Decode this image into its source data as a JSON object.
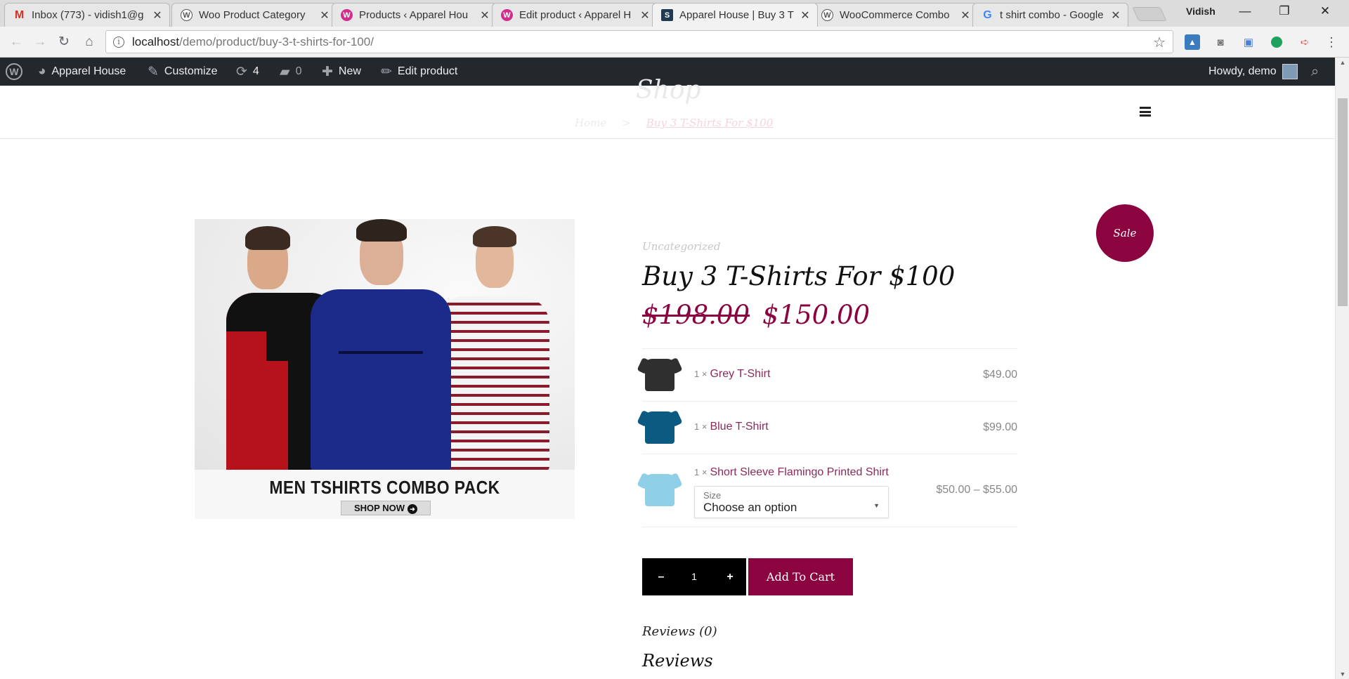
{
  "browser": {
    "tabs": [
      {
        "title": "Inbox (773) - vidish1@g",
        "icon": "gmail-icon",
        "color": "#d93025"
      },
      {
        "title": "Woo Product Category",
        "icon": "wordpress-icon",
        "color": "#555555"
      },
      {
        "title": "Products ‹ Apparel Hou",
        "icon": "woocommerce-icon",
        "color": "#d42c8d"
      },
      {
        "title": "Edit product ‹ Apparel H",
        "icon": "woocommerce-icon",
        "color": "#d42c8d"
      },
      {
        "title": "Apparel House | Buy 3 T",
        "icon": "site-icon",
        "color": "#1f3a52"
      },
      {
        "title": "WooCommerce Combo",
        "icon": "wordpress-icon",
        "color": "#555555"
      },
      {
        "title": "t shirt combo - Google",
        "icon": "google-icon",
        "color": "#4285f4"
      }
    ],
    "profile": "Vidish",
    "url_host": "localhost",
    "url_path": "/demo/product/buy-3-t-shirts-for-100/"
  },
  "adminbar": {
    "site_name": "Apparel House",
    "customize": "Customize",
    "updates": "4",
    "comments": "0",
    "new": "New",
    "edit_product": "Edit product",
    "howdy": "Howdy, demo"
  },
  "header": {
    "page_title": "Shop",
    "breadcrumb_home": "Home",
    "breadcrumb_sep": ">",
    "breadcrumb_current": "Buy 3 T-Shirts For $100"
  },
  "product": {
    "image_caption": "MEN TSHIRTS COMBO PACK",
    "image_button": "SHOP NOW",
    "sale_badge": "Sale",
    "category": "Uncategorized",
    "title": "Buy 3 T-Shirts For $100",
    "regular_price": "$198.00",
    "sale_price": "$150.00",
    "items": [
      {
        "qty": "1 ×",
        "name": "Grey T-Shirt",
        "price": "$49.00",
        "color": "#2f2f2f"
      },
      {
        "qty": "1 ×",
        "name": "Blue T-Shirt",
        "price": "$99.00",
        "color": "#0b5a82"
      },
      {
        "qty": "1 ×",
        "name": "Short Sleeve Flamingo Printed Shirt",
        "price": "$50.00 – $55.00",
        "color": "#8fd0e6",
        "select_label": "Size",
        "select_value": "Choose an option"
      }
    ],
    "quantity": "1",
    "qty_minus": "–",
    "qty_plus": "+",
    "add_to_cart": "Add To Cart",
    "reviews_tab": "Reviews (0)",
    "reviews_heading": "Reviews"
  },
  "colors": {
    "accent": "#8b0440",
    "adminbar": "#23282d"
  }
}
